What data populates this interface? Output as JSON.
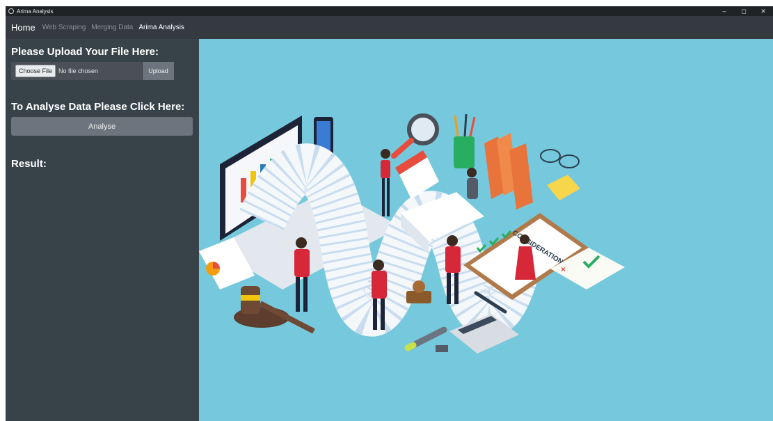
{
  "window": {
    "title": "Arima Analysis",
    "controls": [
      "–",
      "◻",
      "✕"
    ]
  },
  "navbar": {
    "brand": "Home",
    "links": [
      "Web Scraping",
      "Merging Data",
      "Arima Analysis"
    ],
    "active_index": 2
  },
  "upload": {
    "heading": "Please Upload Your File Here:",
    "choose_label": "Choose File",
    "file_status": "No file chosen",
    "upload_label": "Upload"
  },
  "analyse": {
    "heading": "To Analyse Data Please Click Here:",
    "button_label": "Analyse"
  },
  "result": {
    "heading": "Result:"
  },
  "illustration": {
    "sign_text": "CONSIDERATIONS",
    "background_color": "#76c9dc"
  }
}
